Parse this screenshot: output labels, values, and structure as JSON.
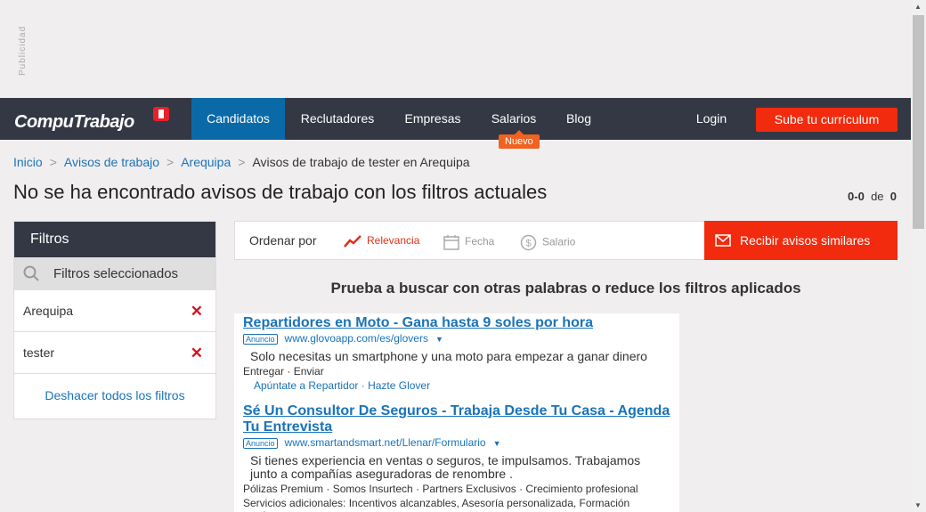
{
  "ad_label": "Publicidad",
  "header": {
    "logo": "CompuTrabajo",
    "nav": [
      "Candidatos",
      "Reclutadores",
      "Empresas",
      "Salarios",
      "Blog"
    ],
    "badge": "Nuevo",
    "login": "Login",
    "cta": "Sube tu currículum"
  },
  "breadcrumb": [
    "Inicio",
    "Avisos de trabajo",
    "Arequipa",
    "Avisos de trabajo de tester en Arequipa"
  ],
  "page": {
    "title": "No se ha encontrado avisos de trabajo con los filtros actuales",
    "range": "0-0",
    "of": "de",
    "total": "0"
  },
  "filters": {
    "title": "Filtros",
    "selected": "Filtros seleccionados",
    "items": [
      "Arequipa",
      "tester"
    ],
    "undo": "Deshacer todos los filtros"
  },
  "sort": {
    "label": "Ordenar por",
    "options": [
      "Relevancia",
      "Fecha",
      "Salario"
    ],
    "alert": "Recibir avisos similares"
  },
  "suggestion": "Prueba a buscar con otras palabras o reduce los filtros aplicados",
  "ads": [
    {
      "title": "Repartidores en Moto - Gana hasta 9 soles por hora",
      "tag": "Anuncio",
      "url": "www.glovoapp.com/es/glovers",
      "desc": "Solo necesitas un smartphone y una moto para empezar a ganar dinero",
      "links": "Entregar · Enviar",
      "sublinks": "Apúntate a Repartidor · Hazte Glover"
    },
    {
      "title": "Sé Un Consultor De Seguros - Trabaja Desde Tu Casa - Agenda Tu Entrevista",
      "tag": "Anuncio",
      "url": "www.smartandsmart.net/Llenar/Formulario",
      "desc": "Si tienes experiencia en ventas o seguros, te impulsamos. Trabajamos junto a compañías aseguradoras de renombre .",
      "links": "Pólizas Premium · Somos Insurtech · Partners Exclusivos · Crecimiento profesional",
      "extra": "Servicios adicionales: Incentivos alcanzables, Asesoría personalizada, Formación continua"
    }
  ],
  "colors": {
    "header_bg": "#333844",
    "active_nav": "#0a6aa8",
    "accent": "#f22b0e",
    "link": "#1a73b9"
  }
}
